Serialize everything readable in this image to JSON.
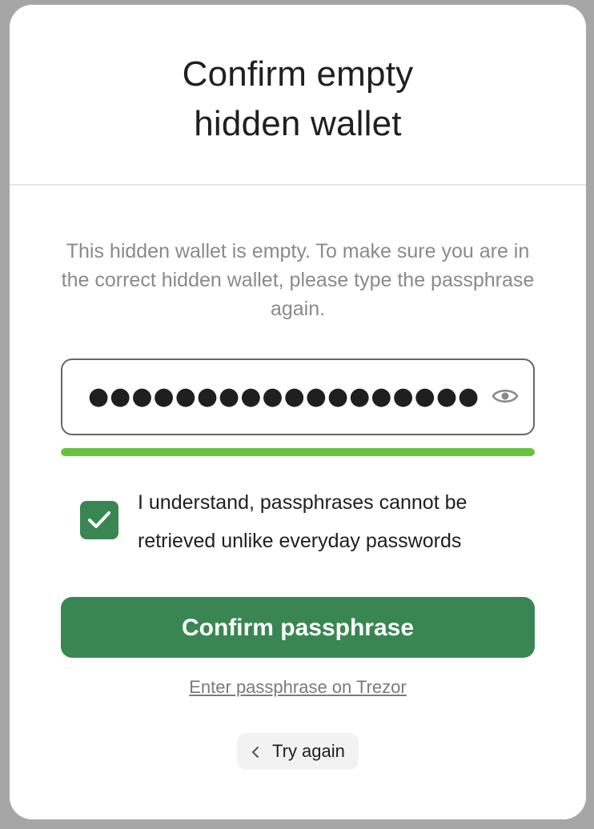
{
  "modal": {
    "title_line1": "Confirm empty",
    "title_line2": "hidden wallet",
    "description": "This hidden wallet is empty. To make sure you are in the correct hidden wallet, please type the passphrase again.",
    "passphrase": {
      "masked_value": "●●●●●●●●●●●●●●●●●●",
      "visibility_icon": "eye-icon",
      "strength_fraction": 1.0,
      "strength_color": "#66c33b"
    },
    "checkbox": {
      "checked": true,
      "label": "I understand, passphrases cannot be retrieved unlike everyday passwords"
    },
    "confirm_button": "Confirm passphrase",
    "trezor_link": "Enter passphrase on Trezor",
    "try_again": "Try again"
  },
  "colors": {
    "accent": "#3a8653",
    "strength": "#66c33b"
  }
}
